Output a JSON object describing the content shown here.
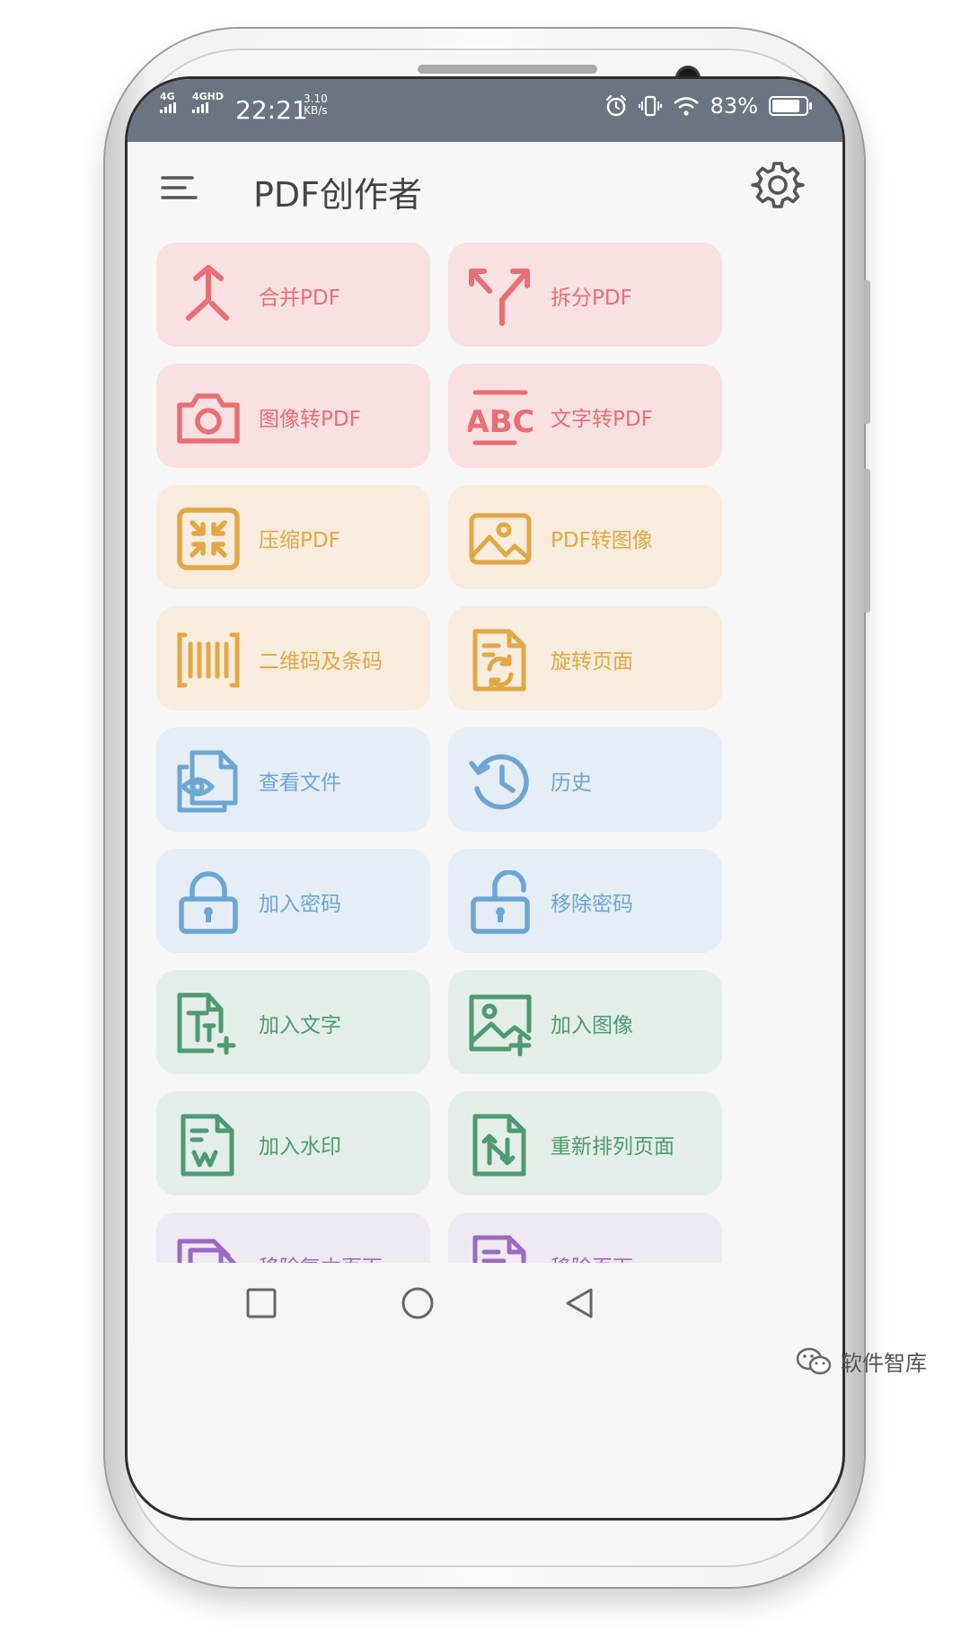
{
  "status_bar": {
    "network_1": "4G",
    "network_2": "4GHD",
    "time": "22:21",
    "speed_value": "3.10",
    "speed_unit": "KB/s",
    "battery": "83%",
    "battery_level": 0.83
  },
  "app_bar": {
    "title": "PDF创作者",
    "menu_icon": "hamburger-menu-icon",
    "settings_icon": "gear-icon"
  },
  "colors": {
    "red_bg": "#f9e0e1",
    "red_fg": "#e96e75",
    "orange_bg": "#f7ecdd",
    "orange_fg": "#e2a846",
    "blue_bg": "#e5edf5",
    "blue_fg": "#6da6d3",
    "green_bg": "#e4eee8",
    "green_fg": "#4e9a72",
    "purple_bg": "#efe9f3",
    "purple_fg": "#9a6bc0"
  },
  "tools": [
    {
      "label": "合并PDF",
      "icon": "merge-icon"
    },
    {
      "label": "拆分PDF",
      "icon": "split-icon"
    },
    {
      "label": "图像转PDF",
      "icon": "camera-icon"
    },
    {
      "label": "文字转PDF",
      "icon": "abc-text-icon"
    },
    {
      "label": "压缩PDF",
      "icon": "compress-icon"
    },
    {
      "label": "PDF转图像",
      "icon": "image-icon"
    },
    {
      "label": "二维码及条码",
      "icon": "barcode-icon"
    },
    {
      "label": "旋转页面",
      "icon": "rotate-page-icon"
    },
    {
      "label": "查看文件",
      "icon": "view-file-icon"
    },
    {
      "label": "历史",
      "icon": "history-icon"
    },
    {
      "label": "加入密码",
      "icon": "lock-icon"
    },
    {
      "label": "移除密码",
      "icon": "unlock-icon"
    },
    {
      "label": "加入文字",
      "icon": "add-text-icon"
    },
    {
      "label": "加入图像",
      "icon": "add-image-icon"
    },
    {
      "label": "加入水印",
      "icon": "watermark-icon"
    },
    {
      "label": "重新排列页面",
      "icon": "rearrange-pages-icon"
    },
    {
      "label": "移除复本页面",
      "icon": "remove-duplicate-pages-icon"
    },
    {
      "label": "移除页面",
      "icon": "remove-pages-icon"
    }
  ],
  "nav_bar": {
    "recents_icon": "square-recents-icon",
    "home_icon": "circle-home-icon",
    "back_icon": "triangle-back-icon"
  },
  "watermark": {
    "text": "软件智库",
    "icon": "wechat-icon"
  }
}
